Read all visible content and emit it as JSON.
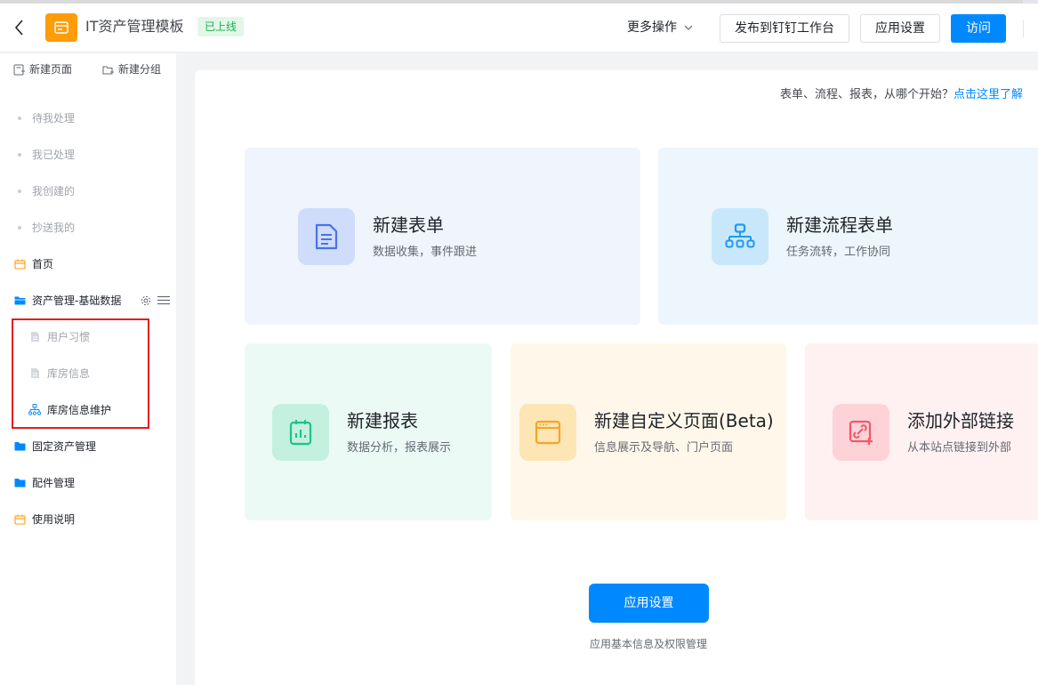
{
  "header": {
    "app_title": "IT资产管理模板",
    "status": "已上线",
    "more_actions": "更多操作",
    "publish_button": "发布到钉钉工作台",
    "settings_button": "应用设置",
    "visit_button": "访问"
  },
  "sidebar": {
    "new_page": "新建页面",
    "new_group": "新建分组",
    "quick_items": [
      "待我处理",
      "我已处理",
      "我创建的",
      "抄送我的"
    ],
    "home": "首页",
    "group_base": "资产管理-基础数据",
    "sub_items": [
      "用户习惯",
      "库房信息",
      "库房信息维护"
    ],
    "fixed_assets": "固定资产管理",
    "parts": "配件管理",
    "manual": "使用说明"
  },
  "main": {
    "hint_text": "表单、流程、报表，从哪个开始？",
    "hint_link": "点击这里了解",
    "cards": [
      {
        "title": "新建表单",
        "desc": "数据收集，事件跟进"
      },
      {
        "title": "新建流程表单",
        "desc": "任务流转，工作协同"
      },
      {
        "title": "新建报表",
        "desc": "数据分析，报表展示"
      },
      {
        "title": "新建自定义页面(Beta)",
        "desc": "信息展示及导航、门户页面"
      },
      {
        "title": "添加外部链接",
        "desc": "从本站点链接到外部"
      }
    ],
    "app_settings_button": "应用设置",
    "app_settings_caption": "应用基本信息及权限管理"
  },
  "colors": {
    "accent": "#0089ff",
    "logo": "#ff9c07",
    "status_green": "#1bb04f",
    "highlight_red": "#e02020"
  }
}
